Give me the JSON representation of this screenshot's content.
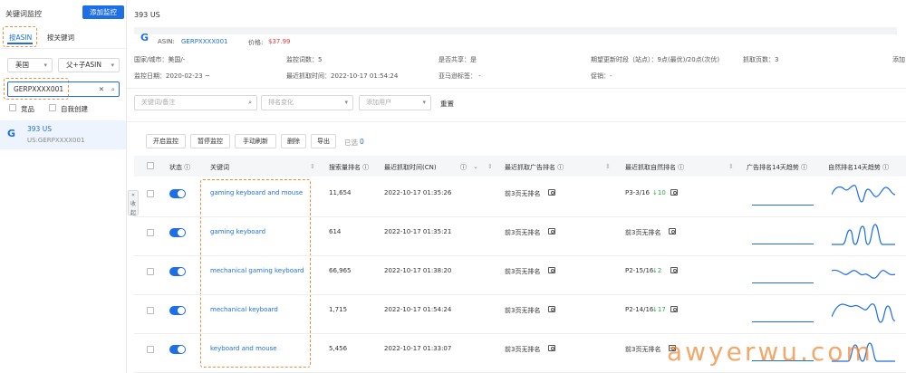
{
  "sidebar": {
    "title": "关键词监控",
    "add_button": "添加监控",
    "tabs": [
      "按ASIN",
      "按关键词"
    ],
    "country": "美国",
    "variant": "父+子ASIN",
    "search_value": "GERPXXXX001",
    "check_competitor": "竞品",
    "check_self": "自我创建",
    "item_title": "393 US",
    "item_sub": "US:GERPXXXX001"
  },
  "product": {
    "title": "393 US",
    "asin_label": "ASIN:",
    "asin": "GERPXXXX001",
    "price_label": "价格:",
    "price": "$37.99",
    "country": "国家/城市：美国/-",
    "monitor_count": "监控词数：5",
    "share": "是否共享：是",
    "expect": "期望更新时段（站点）：9点(最优)/20点(次优)",
    "pages": "抓取页数：3",
    "add_short": "添加",
    "start_date": "监控日期：2020-02-23 ~",
    "last_time": "最近抓取时间：2022-10-17 01:54:24",
    "amazon_tag": "亚马逊标签：  -",
    "promo": "促销：-"
  },
  "filters": {
    "keyword_placeholder": "关键词/备注",
    "rank_change_placeholder": "排名变化",
    "user_placeholder": "添加用户",
    "reset": "重置"
  },
  "toolbar": {
    "buttons": [
      "开启监控",
      "暂停监控",
      "手动刷新",
      "删除",
      "导出"
    ],
    "selected": "已选",
    "selected_count": "0"
  },
  "table": {
    "headers": [
      "状态",
      "关键词",
      "搜索量排名",
      "最近抓取时间(CN)",
      "最近抓取广告排名",
      "最近抓取自然排名",
      "广告排名14天趋势",
      "自然排名14天趋势"
    ],
    "rows": [
      {
        "keyword": "gaming keyboard and mouse",
        "search_rank": "11,654",
        "time": "2022-10-17 01:35:26",
        "ad_rank": "前3页无排名",
        "organic": "P3-3/16",
        "delta": "↓10"
      },
      {
        "keyword": "gaming keyboard",
        "search_rank": "614",
        "time": "2022-10-17 01:35:21",
        "ad_rank": "前3页无排名",
        "organic": "前3页无排名",
        "delta": ""
      },
      {
        "keyword": "mechanical gaming keyboard",
        "search_rank": "66,965",
        "time": "2022-10-17 01:38:20",
        "ad_rank": "前3页无排名",
        "organic": "P2-15/16",
        "delta": "↓2"
      },
      {
        "keyword": "mechanical keyboard",
        "search_rank": "1,715",
        "time": "2022-10-17 01:54:24",
        "ad_rank": "前3页无排名",
        "organic": "P2-14/16",
        "delta": "↓17"
      },
      {
        "keyword": "keyboard and mouse",
        "search_rank": "5,456",
        "time": "2022-10-17 01:33:07",
        "ad_rank": "前3页无排名",
        "organic": "前3页无排名",
        "delta": ""
      }
    ]
  },
  "collapse_label": "收起",
  "watermark": "awyerwu.com",
  "colors": {
    "accent": "#1e6fe6",
    "dash": "#f08c3c",
    "green": "#2aa744",
    "price": "#e23b3b"
  }
}
